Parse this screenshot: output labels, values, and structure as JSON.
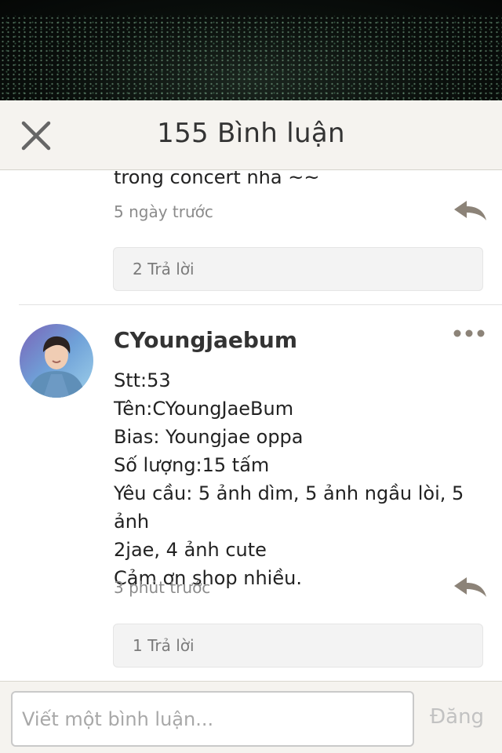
{
  "header": {
    "title": "155 Bình luận",
    "close_icon": "close-icon"
  },
  "previous_comment": {
    "cut_text": "trong concert nha ~~",
    "time": "5 ngày trước",
    "replies": "2 Trả lời"
  },
  "comment": {
    "username": "CYoungjaebum",
    "lines": [
      "Stt:53",
      "Tên:CYoungJaeBum",
      "Bias: Youngjae oppa",
      "Số lượng:15 tấm",
      "Yêu cầu: 5 ảnh dìm, 5 ảnh ngầu lòi, 5 ảnh",
      "2jae, 4 ảnh cute",
      "Cảm ơn shop nhiều."
    ],
    "time": "3 phút trước",
    "replies": "1 Trả lời"
  },
  "composer": {
    "placeholder": "Viết một bình luận...",
    "post_label": "Đăng"
  },
  "colors": {
    "header_bg": "#f5f3ef",
    "reply_icon": "#8c8378",
    "muted_text": "#8b8b8b"
  }
}
